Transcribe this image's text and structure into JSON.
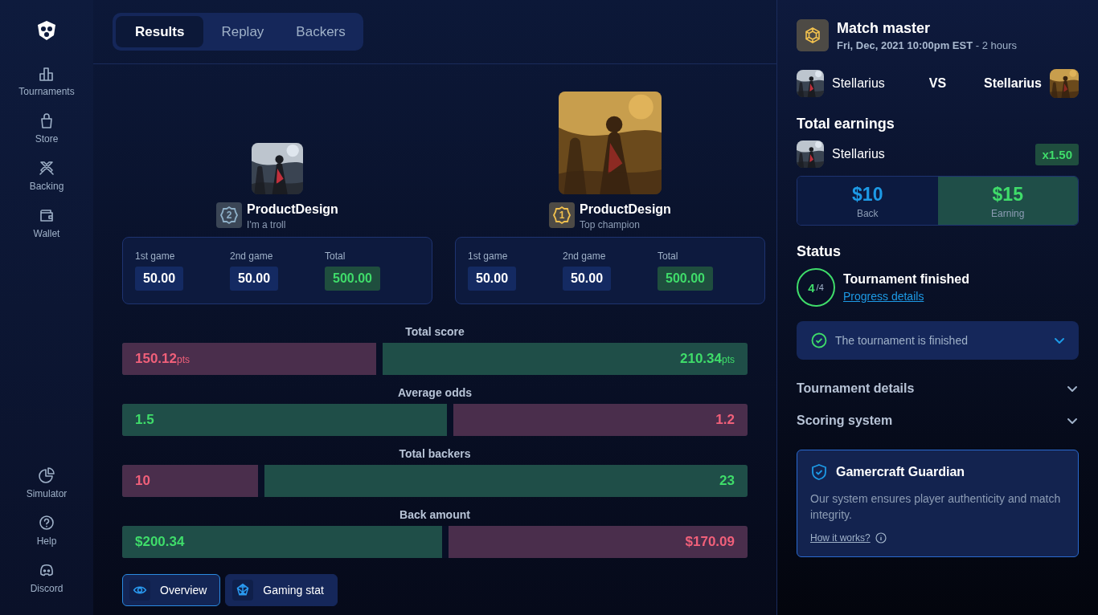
{
  "sidebar": {
    "top": [
      {
        "label": "Tournaments"
      },
      {
        "label": "Store"
      },
      {
        "label": "Backing"
      },
      {
        "label": "Wallet"
      }
    ],
    "bottom": [
      {
        "label": "Simulator"
      },
      {
        "label": "Help"
      },
      {
        "label": "Discord"
      }
    ]
  },
  "tabs": [
    {
      "label": "Results",
      "selected": true
    },
    {
      "label": "Replay",
      "selected": false
    },
    {
      "label": "Backers",
      "selected": false
    }
  ],
  "players": [
    {
      "name": "ProductDesign",
      "subtitle": "I'm a troll",
      "rank": "2",
      "color": "#8fb0c8",
      "games": [
        {
          "label": "1st game",
          "value": "50.00",
          "kind": "plain"
        },
        {
          "label": "2nd game",
          "value": "50.00",
          "kind": "plain"
        },
        {
          "label": "Total",
          "value": "500.00",
          "kind": "total"
        }
      ]
    },
    {
      "name": "ProductDesign",
      "subtitle": "Top champion",
      "rank": "1",
      "color": "#f2c14e",
      "games": [
        {
          "label": "1st game",
          "value": "50.00",
          "kind": "plain"
        },
        {
          "label": "2nd game",
          "value": "50.00",
          "kind": "plain"
        },
        {
          "label": "Total",
          "value": "500.00",
          "kind": "total"
        }
      ]
    }
  ],
  "comparison": [
    {
      "title": "Total score",
      "level": 0.417,
      "left": {
        "value": "150.12",
        "unit": "pts",
        "leading": false
      },
      "right": {
        "value": "210.34",
        "unit": "pts",
        "leading": true
      }
    },
    {
      "title": "Average odds",
      "level": 0.53,
      "left": {
        "value": "1.5",
        "leading": true
      },
      "right": {
        "value": "1.2",
        "leading": false
      }
    },
    {
      "title": "Total backers",
      "level": 0.227,
      "left": {
        "value": "10",
        "leading": false
      },
      "right": {
        "value": "23",
        "leading": true
      }
    },
    {
      "title": "Back amount",
      "level": 0.522,
      "left": {
        "value": "$200.34",
        "leading": true
      },
      "right": {
        "value": "$170.09",
        "leading": false
      }
    }
  ],
  "bottom_tabs": [
    {
      "label": "Overview",
      "selected": true
    },
    {
      "label": "Gaming stat",
      "selected": false
    }
  ],
  "match": {
    "title": "Match master",
    "date": "**Fri, Dec, 2021 10:00pm EST** - 2 hours",
    "left_player": "Stellarius",
    "versus": "VS",
    "right_player": "Stellarius"
  },
  "earnings": {
    "title": "Total earnings",
    "player": "Stellarius",
    "multiplier": "x1.50",
    "back": {
      "amount": "$10",
      "label": "Back"
    },
    "earning": {
      "amount": "$15",
      "label": "Earning"
    }
  },
  "status": {
    "title": "Status",
    "done": "4",
    "total": "/4",
    "headline": "Tournament finished",
    "link": "Progress details",
    "notice": "The tournament is finished"
  },
  "accordions": [
    {
      "label": "Tournament details",
      "expanded": false
    },
    {
      "label": "Scoring system",
      "expanded": false
    }
  ],
  "guardian": {
    "title": "Gamercraft Guardian",
    "text": "Our system ensures player authenticity and match integrity.",
    "link": "How it works?"
  }
}
